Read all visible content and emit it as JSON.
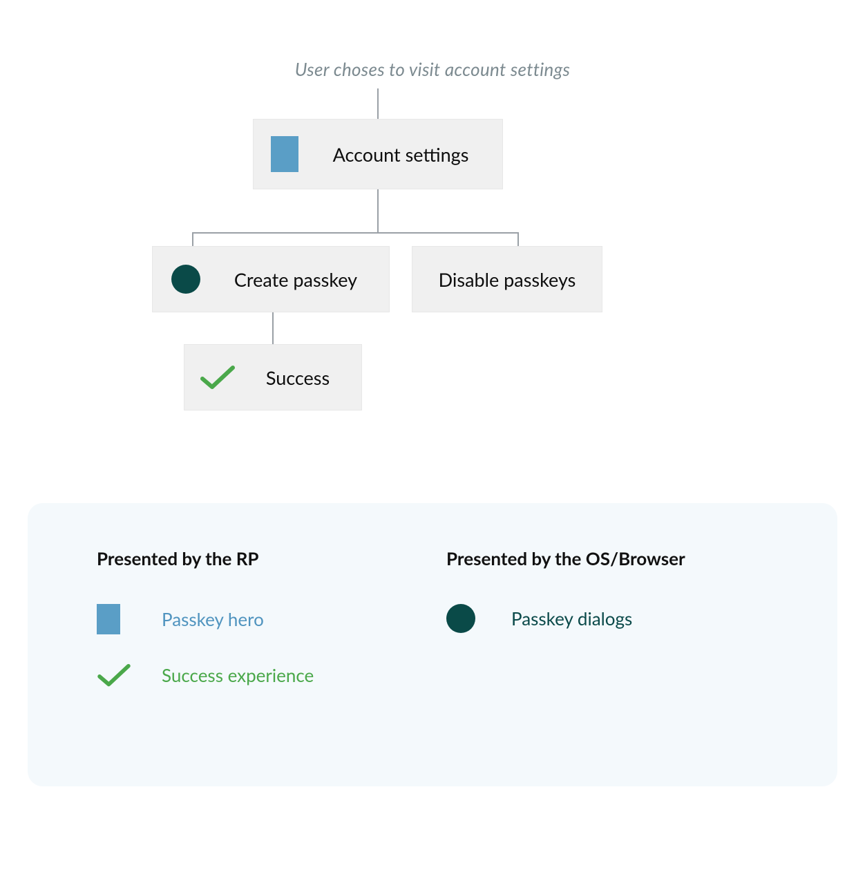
{
  "caption": "User choses to visit account settings",
  "nodes": {
    "account_settings": "Account settings",
    "create_passkey": "Create passkey",
    "disable_passkeys": "Disable passkeys",
    "success": "Success"
  },
  "legend": {
    "rp_title": "Presented by the RP",
    "os_title": "Presented by the OS/Browser",
    "passkey_hero": "Passkey hero",
    "success_experience": "Success experience",
    "passkey_dialogs": "Passkey dialogs"
  },
  "icons": {
    "passkey_hero": "passkey-hero-icon",
    "passkey_dialogs": "passkey-dialogs-icon",
    "success_check": "success-check-icon"
  },
  "colors": {
    "hero_blue": "#5a9ec6",
    "dialog_teal": "#0a4a48",
    "success_green": "#4aa84a",
    "node_bg": "#f0f0f0",
    "legend_bg": "#f4f9fc",
    "caption_gray": "#7c8a90",
    "connector": "#9aa0a6",
    "legend_blue_text": "#5094bf",
    "legend_teal_text": "#0b4a4a"
  }
}
